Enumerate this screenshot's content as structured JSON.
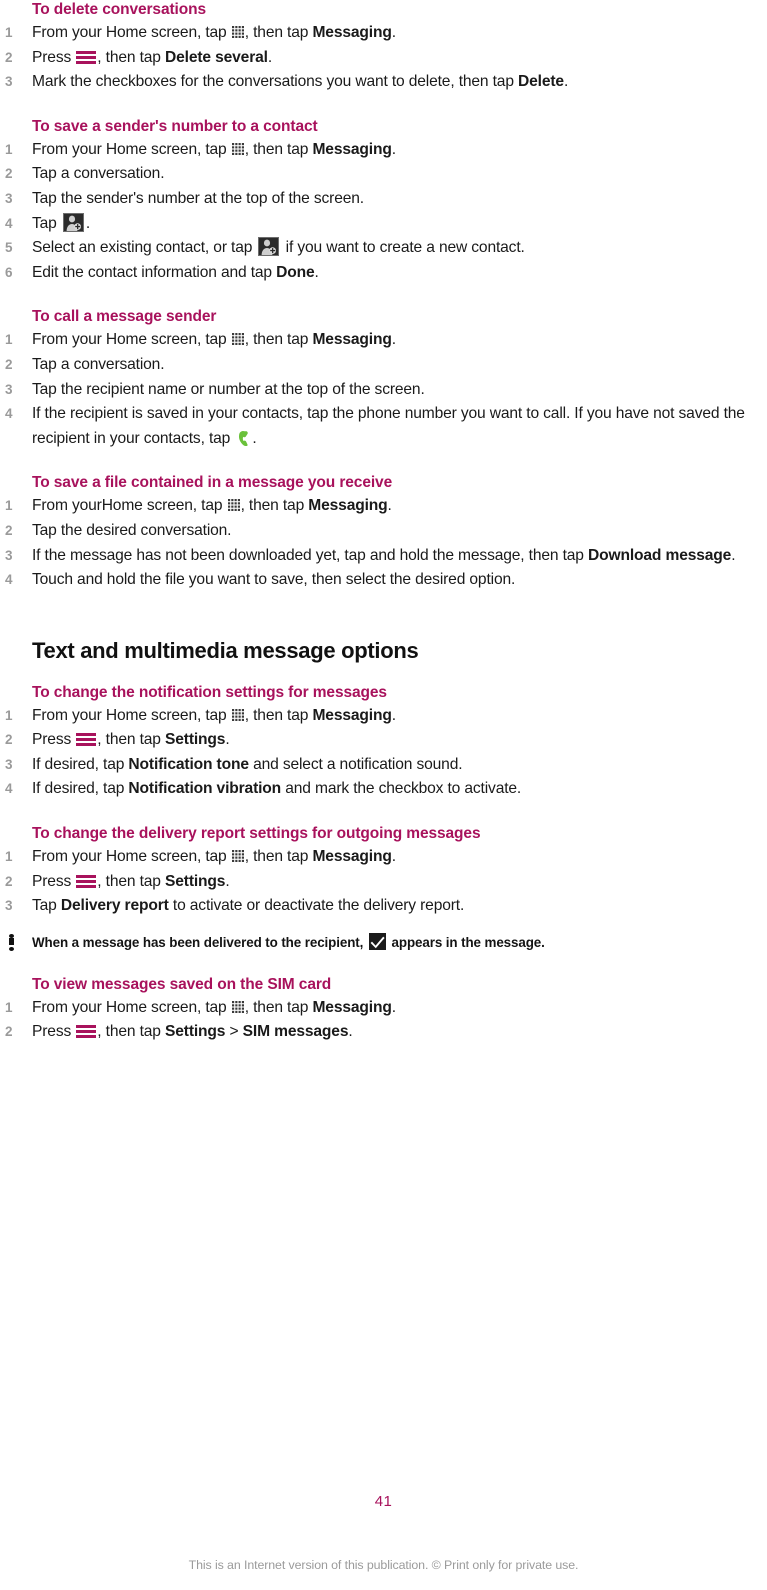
{
  "page": {
    "number": "41",
    "footer_note": "This is an Internet version of this publication. © Print only for private use.",
    "accent_color": "#a8125c",
    "text_color": "#1a1a1a",
    "step_number_color": "#9a9a9a",
    "phone_icon_color": "#6ac13a"
  },
  "sections": [
    {
      "id": "delete-conversations",
      "heading": "To delete conversations",
      "steps": [
        {
          "parts": [
            {
              "t": "text",
              "v": "From your Home screen, tap "
            },
            {
              "t": "icon",
              "v": "apps-grid-icon"
            },
            {
              "t": "text",
              "v": ", then tap "
            },
            {
              "t": "bold",
              "v": "Messaging"
            },
            {
              "t": "text",
              "v": "."
            }
          ]
        },
        {
          "parts": [
            {
              "t": "text",
              "v": "Press "
            },
            {
              "t": "icon",
              "v": "menu-icon"
            },
            {
              "t": "text",
              "v": ", then tap "
            },
            {
              "t": "bold",
              "v": "Delete several"
            },
            {
              "t": "text",
              "v": "."
            }
          ]
        },
        {
          "parts": [
            {
              "t": "text",
              "v": "Mark the checkboxes for the conversations you want to delete, then tap "
            },
            {
              "t": "bold",
              "v": "Delete"
            },
            {
              "t": "text",
              "v": "."
            }
          ]
        }
      ]
    },
    {
      "id": "save-sender-number",
      "heading": "To save a sender's number to a contact",
      "steps": [
        {
          "parts": [
            {
              "t": "text",
              "v": "From your Home screen, tap "
            },
            {
              "t": "icon",
              "v": "apps-grid-icon"
            },
            {
              "t": "text",
              "v": ", then tap "
            },
            {
              "t": "bold",
              "v": "Messaging"
            },
            {
              "t": "text",
              "v": "."
            }
          ]
        },
        {
          "parts": [
            {
              "t": "text",
              "v": "Tap a conversation."
            }
          ]
        },
        {
          "parts": [
            {
              "t": "text",
              "v": "Tap the sender's number at the top of the screen."
            }
          ]
        },
        {
          "parts": [
            {
              "t": "text",
              "v": "Tap "
            },
            {
              "t": "icon",
              "v": "add-contact-icon"
            },
            {
              "t": "text",
              "v": "."
            }
          ]
        },
        {
          "parts": [
            {
              "t": "text",
              "v": "Select an existing contact, or tap "
            },
            {
              "t": "icon",
              "v": "add-contact-icon"
            },
            {
              "t": "text",
              "v": " if you want to create a new contact."
            }
          ]
        },
        {
          "parts": [
            {
              "t": "text",
              "v": "Edit the contact information and tap "
            },
            {
              "t": "bold",
              "v": "Done"
            },
            {
              "t": "text",
              "v": "."
            }
          ]
        }
      ]
    },
    {
      "id": "call-message-sender",
      "heading": "To call a message sender",
      "steps": [
        {
          "parts": [
            {
              "t": "text",
              "v": "From your Home screen, tap "
            },
            {
              "t": "icon",
              "v": "apps-grid-icon"
            },
            {
              "t": "text",
              "v": ", then tap "
            },
            {
              "t": "bold",
              "v": "Messaging"
            },
            {
              "t": "text",
              "v": "."
            }
          ]
        },
        {
          "parts": [
            {
              "t": "text",
              "v": "Tap a conversation."
            }
          ]
        },
        {
          "parts": [
            {
              "t": "text",
              "v": "Tap the recipient name or number at the top of the screen."
            }
          ]
        },
        {
          "parts": [
            {
              "t": "text",
              "v": "If the recipient is saved in your contacts, tap the phone number you want to call. If you have not saved the recipient in your contacts, tap "
            },
            {
              "t": "icon",
              "v": "phone-icon"
            },
            {
              "t": "text",
              "v": "."
            }
          ]
        }
      ]
    },
    {
      "id": "save-file-in-message",
      "heading": "To save a file contained in a message you receive",
      "steps": [
        {
          "parts": [
            {
              "t": "text",
              "v": "From yourHome screen, tap "
            },
            {
              "t": "icon",
              "v": "apps-grid-icon"
            },
            {
              "t": "text",
              "v": ", then tap "
            },
            {
              "t": "bold",
              "v": "Messaging"
            },
            {
              "t": "text",
              "v": "."
            }
          ]
        },
        {
          "parts": [
            {
              "t": "text",
              "v": "Tap the desired conversation."
            }
          ]
        },
        {
          "parts": [
            {
              "t": "text",
              "v": "If the message has not been downloaded yet, tap and hold the message, then tap "
            },
            {
              "t": "bold",
              "v": "Download message"
            },
            {
              "t": "text",
              "v": "."
            }
          ]
        },
        {
          "parts": [
            {
              "t": "text",
              "v": "Touch and hold the file you want to save, then select the desired option."
            }
          ]
        }
      ]
    }
  ],
  "chapter": {
    "heading": "Text and multimedia message options",
    "sections": [
      {
        "id": "notification-settings",
        "heading": "To change the notification settings for messages",
        "steps": [
          {
            "parts": [
              {
                "t": "text",
                "v": "From your Home screen, tap "
              },
              {
                "t": "icon",
                "v": "apps-grid-icon"
              },
              {
                "t": "text",
                "v": ", then tap "
              },
              {
                "t": "bold",
                "v": "Messaging"
              },
              {
                "t": "text",
                "v": "."
              }
            ]
          },
          {
            "parts": [
              {
                "t": "text",
                "v": "Press "
              },
              {
                "t": "icon",
                "v": "menu-icon"
              },
              {
                "t": "text",
                "v": ", then tap "
              },
              {
                "t": "bold",
                "v": "Settings"
              },
              {
                "t": "text",
                "v": "."
              }
            ]
          },
          {
            "parts": [
              {
                "t": "text",
                "v": "If desired, tap "
              },
              {
                "t": "bold",
                "v": "Notification tone"
              },
              {
                "t": "text",
                "v": " and select a notification sound."
              }
            ]
          },
          {
            "parts": [
              {
                "t": "text",
                "v": "If desired, tap "
              },
              {
                "t": "bold",
                "v": "Notification vibration"
              },
              {
                "t": "text",
                "v": " and mark the checkbox to activate."
              }
            ]
          }
        ]
      },
      {
        "id": "delivery-report-settings",
        "heading": "To change the delivery report settings for outgoing messages",
        "steps": [
          {
            "parts": [
              {
                "t": "text",
                "v": "From your Home screen, tap "
              },
              {
                "t": "icon",
                "v": "apps-grid-icon"
              },
              {
                "t": "text",
                "v": ", then tap "
              },
              {
                "t": "bold",
                "v": "Messaging"
              },
              {
                "t": "text",
                "v": "."
              }
            ]
          },
          {
            "parts": [
              {
                "t": "text",
                "v": "Press "
              },
              {
                "t": "icon",
                "v": "menu-icon"
              },
              {
                "t": "text",
                "v": ", then tap "
              },
              {
                "t": "bold",
                "v": "Settings"
              },
              {
                "t": "text",
                "v": "."
              }
            ]
          },
          {
            "parts": [
              {
                "t": "text",
                "v": "Tap "
              },
              {
                "t": "bold",
                "v": "Delivery report"
              },
              {
                "t": "text",
                "v": " to activate or deactivate the delivery report."
              }
            ]
          }
        ],
        "note": {
          "parts": [
            {
              "t": "text",
              "v": "When a message has been delivered to the recipient, "
            },
            {
              "t": "icon",
              "v": "delivered-check-icon"
            },
            {
              "t": "text",
              "v": " appears in the message."
            }
          ]
        }
      },
      {
        "id": "view-sim-messages",
        "heading": "To view messages saved on the SIM card",
        "steps": [
          {
            "parts": [
              {
                "t": "text",
                "v": "From your Home screen, tap "
              },
              {
                "t": "icon",
                "v": "apps-grid-icon"
              },
              {
                "t": "text",
                "v": ", then tap "
              },
              {
                "t": "bold",
                "v": "Messaging"
              },
              {
                "t": "text",
                "v": "."
              }
            ]
          },
          {
            "parts": [
              {
                "t": "text",
                "v": "Press "
              },
              {
                "t": "icon",
                "v": "menu-icon"
              },
              {
                "t": "text",
                "v": ", then tap "
              },
              {
                "t": "bold",
                "v": "Settings"
              },
              {
                "t": "text",
                "v": " > "
              },
              {
                "t": "bold",
                "v": "SIM messages"
              },
              {
                "t": "text",
                "v": "."
              }
            ]
          }
        ]
      }
    ]
  }
}
